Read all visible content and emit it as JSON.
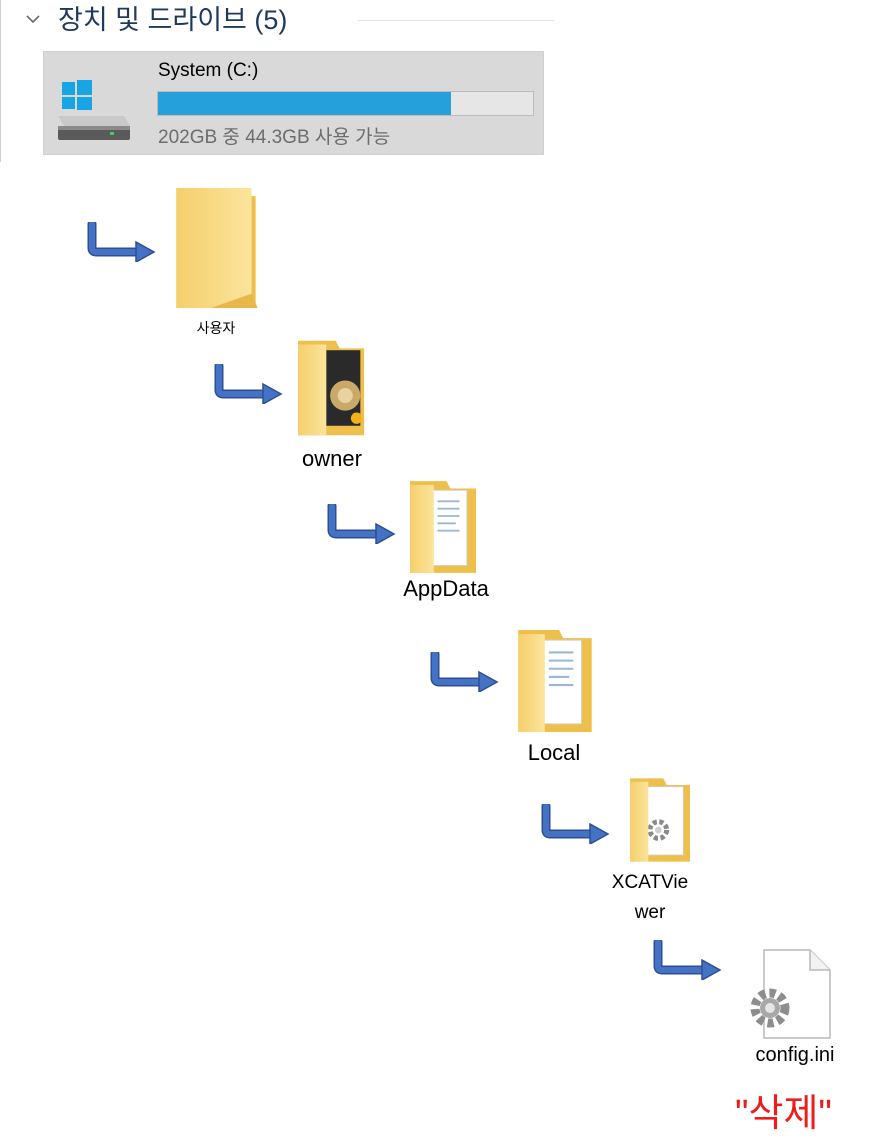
{
  "group": {
    "title": "장치 및 드라이브 (5)"
  },
  "drive": {
    "name": "System (C:)",
    "usage_text": "202GB 중 44.3GB 사용 가능",
    "used_fraction": 0.781,
    "bar_color": "#26a0da"
  },
  "path": [
    {
      "label": "사용자",
      "icon": "folder-icon"
    },
    {
      "label": "owner",
      "icon": "user-folder-icon"
    },
    {
      "label": "AppData",
      "icon": "folder-documents-icon"
    },
    {
      "label": "Local",
      "icon": "folder-documents-icon"
    },
    {
      "label": "XCATViewer",
      "icon": "folder-settings-icon"
    },
    {
      "label": "config.ini",
      "icon": "settings-file-icon"
    }
  ],
  "note": "\"삭제\"",
  "colors": {
    "arrow": "#3a5fb0",
    "note": "#ee1c1c",
    "folder": "#f8d775"
  }
}
